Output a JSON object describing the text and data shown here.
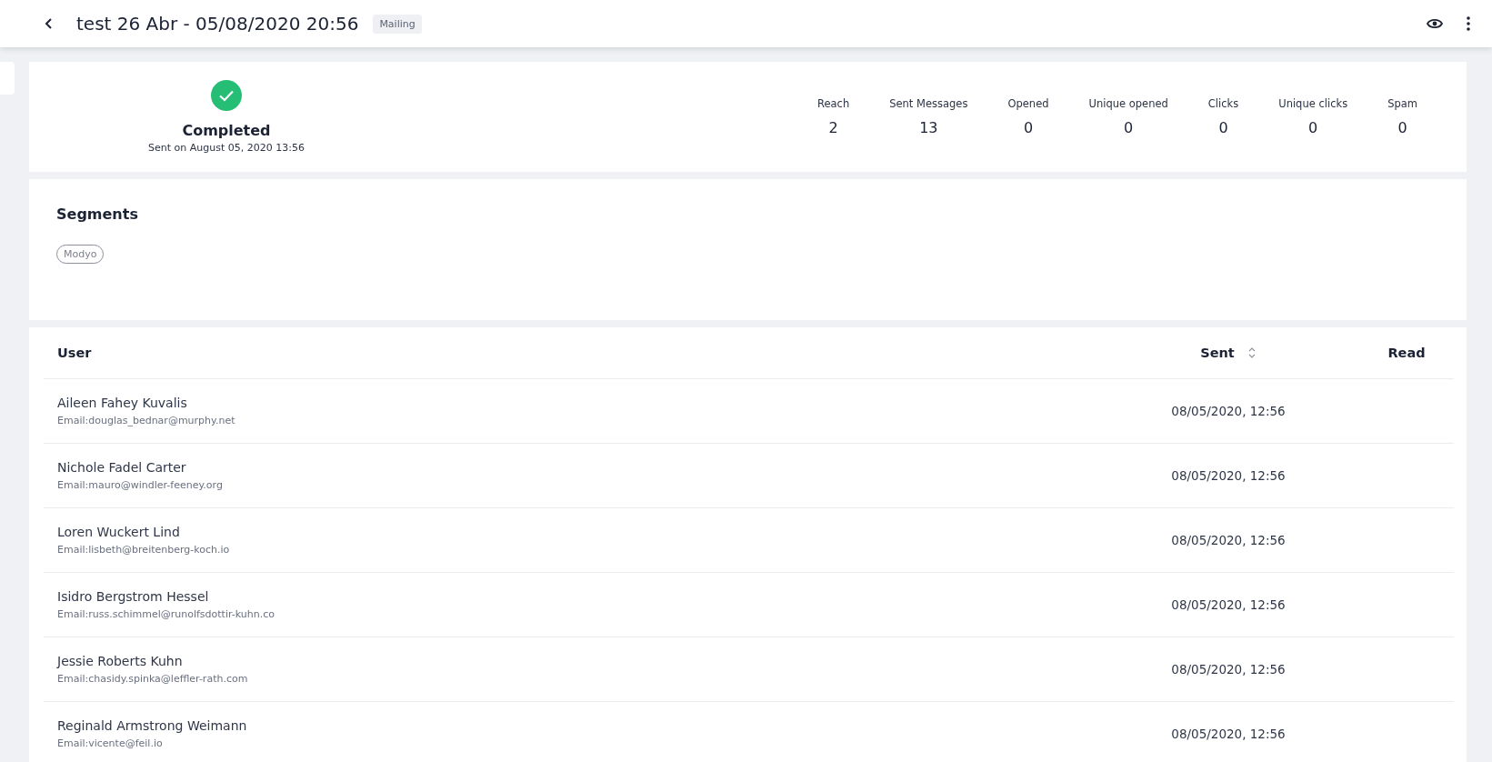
{
  "header": {
    "title": "test 26 Abr - 05/08/2020 20:56",
    "badge": "Mailing"
  },
  "status": {
    "label": "Completed",
    "sent_on": "Sent on August 05, 2020 13:56"
  },
  "stats": [
    {
      "label": "Reach",
      "value": "2"
    },
    {
      "label": "Sent Messages",
      "value": "13"
    },
    {
      "label": "Opened",
      "value": "0"
    },
    {
      "label": "Unique opened",
      "value": "0"
    },
    {
      "label": "Clicks",
      "value": "0"
    },
    {
      "label": "Unique clicks",
      "value": "0"
    },
    {
      "label": "Spam",
      "value": "0"
    }
  ],
  "segments": {
    "title": "Segments",
    "tags": [
      "Modyo"
    ]
  },
  "table": {
    "columns": [
      {
        "label": "User",
        "sortable": false
      },
      {
        "label": "Sent",
        "sortable": true
      },
      {
        "label": "Read",
        "sortable": false
      }
    ],
    "rows": [
      {
        "name": "Aileen Fahey Kuvalis",
        "email": "Email:douglas_bednar@murphy.net",
        "sent": "08/05/2020, 12:56"
      },
      {
        "name": "Nichole Fadel Carter",
        "email": "Email:mauro@windler-feeney.org",
        "sent": "08/05/2020, 12:56"
      },
      {
        "name": "Loren Wuckert Lind",
        "email": "Email:lisbeth@breitenberg-koch.io",
        "sent": "08/05/2020, 12:56"
      },
      {
        "name": "Isidro Bergstrom Hessel",
        "email": "Email:russ.schimmel@runolfsdottir-kuhn.co",
        "sent": "08/05/2020, 12:56"
      },
      {
        "name": "Jessie Roberts Kuhn",
        "email": "Email:chasidy.spinka@leffler-rath.com",
        "sent": "08/05/2020, 12:56"
      },
      {
        "name": "Reginald Armstrong Weimann",
        "email": "Email:vicente@feil.io",
        "sent": "08/05/2020, 12:56"
      }
    ]
  }
}
